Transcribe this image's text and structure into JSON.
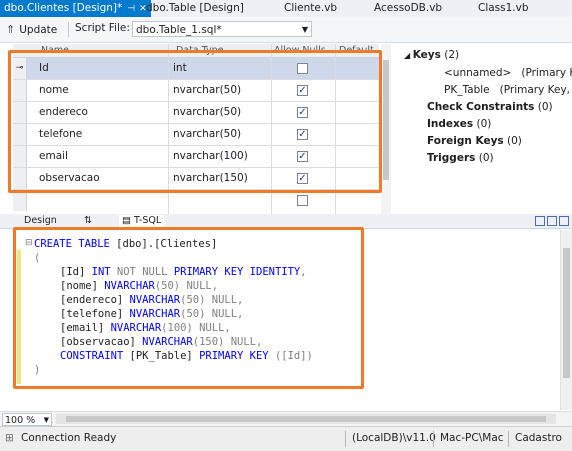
{
  "tabs": [
    {
      "label": "dbo.Clientes [Design]*",
      "active": true
    },
    {
      "label": "dbo.Table [Design]"
    },
    {
      "label": "Cliente.vb"
    },
    {
      "label": "AcessoDB.vb"
    },
    {
      "label": "Class1.vb"
    }
  ],
  "toolbar": {
    "update_label": "Update",
    "script_file_label": "Script File:",
    "script_file_value": "dbo.Table_1.sql*"
  },
  "grid": {
    "columns": [
      "Name",
      "Data Type",
      "Allow Nulls",
      "Default"
    ],
    "rows": [
      {
        "name": "Id",
        "type": "int",
        "allow_nulls": false,
        "key": true
      },
      {
        "name": "nome",
        "type": "nvarchar(50)",
        "allow_nulls": true
      },
      {
        "name": "endereco",
        "type": "nvarchar(50)",
        "allow_nulls": true
      },
      {
        "name": "telefone",
        "type": "nvarchar(50)",
        "allow_nulls": true
      },
      {
        "name": "email",
        "type": "nvarchar(100)",
        "allow_nulls": true
      },
      {
        "name": "observacao",
        "type": "nvarchar(150)",
        "allow_nulls": true
      }
    ]
  },
  "properties": {
    "keys_label": "Keys",
    "keys_count": "(2)",
    "key1_name": "<unnamed>",
    "key1_desc": "(Primary Key",
    "key2_name": "PK_Table",
    "key2_desc": "(Primary Key, Cl",
    "check_label": "Check Constraints",
    "check_count": "(0)",
    "indexes_label": "Indexes",
    "indexes_count": "(0)",
    "fk_label": "Foreign Keys",
    "fk_count": "(0)",
    "triggers_label": "Triggers",
    "triggers_count": "(0)"
  },
  "pane_tabs": {
    "design": "Design",
    "tsql": "T-SQL"
  },
  "sql": {
    "l1_kw": "CREATE TABLE",
    "l1_tx": " [dbo].[Clientes]",
    "l2": "(",
    "l3_id": "[Id]",
    "l3_kw": " INT",
    "l3_gr": " NOT NULL",
    "l3_kw2": " PRIMARY KEY IDENTITY",
    "l4_n": "[nome]",
    "l4_t": " NVARCHAR",
    "l4_s": "(50)",
    "l4_e": " NULL,",
    "l5_n": "[endereco]",
    "l5_t": " NVARCHAR",
    "l5_s": "(50)",
    "l5_e": " NULL,",
    "l6_n": "[telefone]",
    "l6_t": " NVARCHAR",
    "l6_s": "(50)",
    "l6_e": " NULL,",
    "l7_n": "[email]",
    "l7_t": " NVARCHAR",
    "l7_s": "(100)",
    "l7_e": " NULL,",
    "l8_n": "[observacao]",
    "l8_t": " NVARCHAR",
    "l8_s": "(150)",
    "l8_e": " NULL,",
    "l9_kw": "CONSTRAINT",
    "l9_tx": " [PK_Table]",
    "l9_kw2": " PRIMARY KEY",
    "l9_gr": " ([Id])",
    "l10": ")"
  },
  "zoom": "100 %",
  "status": {
    "connection": "Connection Ready",
    "server": "(LocalDB)\\v11.0",
    "user": "Mac-PC\\Mac",
    "db": "Cadastro"
  },
  "colors": {
    "accent": "#007acc",
    "highlight": "#f07a28",
    "keyword": "#0000ff"
  }
}
